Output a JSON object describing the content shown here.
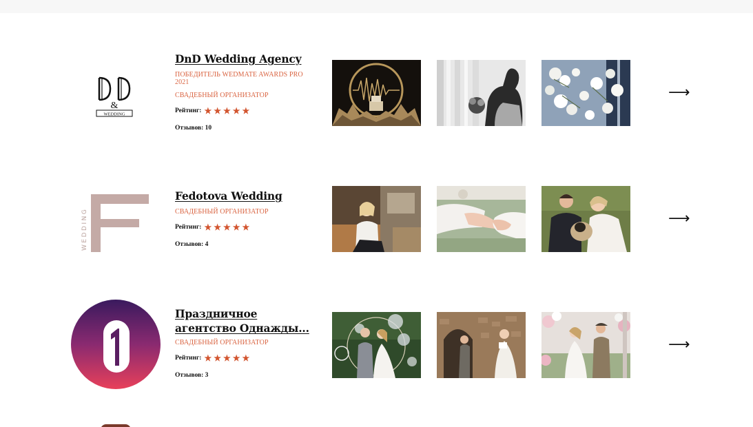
{
  "agencies": [
    {
      "title": "DnD Wedding Agency",
      "tags": [
        "ПОБЕДИТЕЛЬ WEDMATE AWARDS PRO 2021",
        "СВАДЕБНЫЙ ОРГАНИЗАТОР"
      ],
      "rating_label": "Рейтинг:",
      "rating": 5,
      "reviews": "Отзывов: 10",
      "logo_text": "D&D WEDDING"
    },
    {
      "title": "Fedotova Wedding",
      "tags": [
        "СВАДЕБНЫЙ ОРГАНИЗАТОР"
      ],
      "rating_label": "Рейтинг:",
      "rating": 5,
      "reviews": "Отзывов: 4",
      "logo_text": "WEDDING"
    },
    {
      "title": "Праздничное агентство Однажды...",
      "tags": [
        "СВАДЕБНЫЙ ОРГАНИЗАТОР"
      ],
      "rating_label": "Рейтинг:",
      "rating": 5,
      "reviews": "Отзывов: 3",
      "logo_text": ""
    }
  ],
  "arrow": "⟶",
  "colors": {
    "accent": "#d9623f",
    "star": "#d2542e",
    "topbar": "#f7f7f7"
  }
}
